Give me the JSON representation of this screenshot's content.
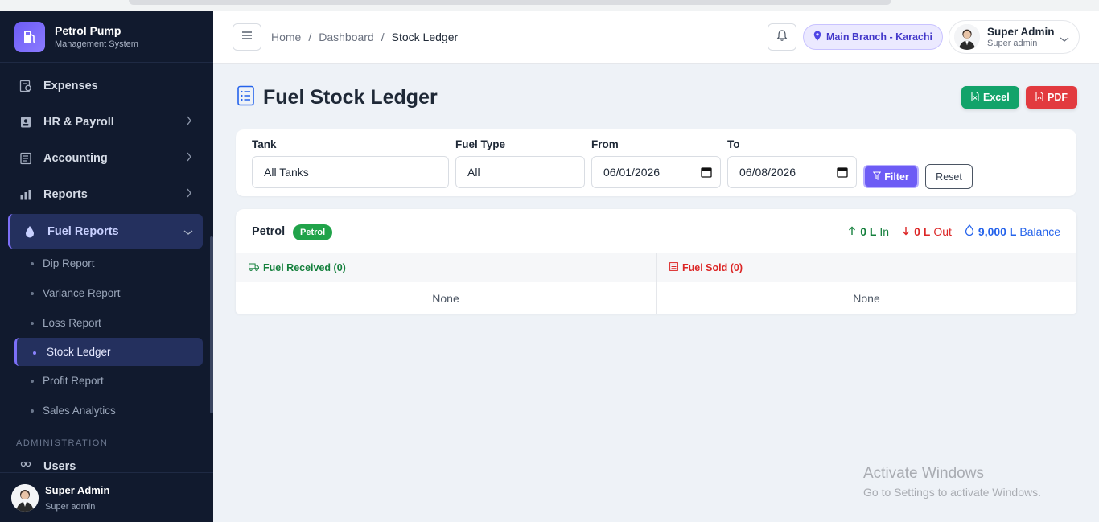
{
  "brand": {
    "title": "Petrol Pump",
    "subtitle": "Management System"
  },
  "sidebar": {
    "items": [
      {
        "label": "Expenses"
      },
      {
        "label": "HR & Payroll"
      },
      {
        "label": "Accounting"
      },
      {
        "label": "Reports"
      },
      {
        "label": "Fuel Reports"
      }
    ],
    "sub_items": [
      {
        "label": "Dip Report"
      },
      {
        "label": "Variance Report"
      },
      {
        "label": "Loss Report"
      },
      {
        "label": "Stock Ledger"
      },
      {
        "label": "Profit Report"
      },
      {
        "label": "Sales Analytics"
      }
    ],
    "section_label": "ADMINISTRATION",
    "users_label": "Users",
    "user": {
      "name": "Super Admin",
      "role": "Super admin"
    }
  },
  "topbar": {
    "breadcrumb": [
      "Home",
      "Dashboard",
      "Stock Ledger"
    ],
    "separator": "/",
    "branch": "Main Branch - Karachi",
    "user": {
      "name": "Super Admin",
      "role": "Super admin"
    }
  },
  "page": {
    "title": "Fuel Stock Ledger",
    "excel_label": "Excel",
    "pdf_label": "PDF"
  },
  "filters": {
    "tank": {
      "label": "Tank",
      "value": "All Tanks"
    },
    "fuel_type": {
      "label": "Fuel Type",
      "value": "All"
    },
    "from": {
      "label": "From",
      "value": "06/01/2026"
    },
    "to": {
      "label": "To",
      "value": "06/08/2026"
    },
    "filter_label": "Filter",
    "reset_label": "Reset"
  },
  "ledger": {
    "tank_name": "Petrol",
    "badge": "Petrol",
    "in_value": "0 L",
    "in_label": "In",
    "out_value": "0 L",
    "out_label": "Out",
    "balance_value": "9,000 L",
    "balance_label": "Balance",
    "received_header": "Fuel Received (0)",
    "sold_header": "Fuel Sold (0)",
    "received_empty": "None",
    "sold_empty": "None"
  },
  "watermark": {
    "line1": "Activate Windows",
    "line2": "Go to Settings to activate Windows."
  },
  "colors": {
    "accent": "#6d5cf5",
    "sidebar_bg": "#111a2e",
    "excel": "#12a36a",
    "pdf": "#e23a3f",
    "in": "#15803d",
    "out": "#dc2626",
    "balance": "#2563eb"
  }
}
